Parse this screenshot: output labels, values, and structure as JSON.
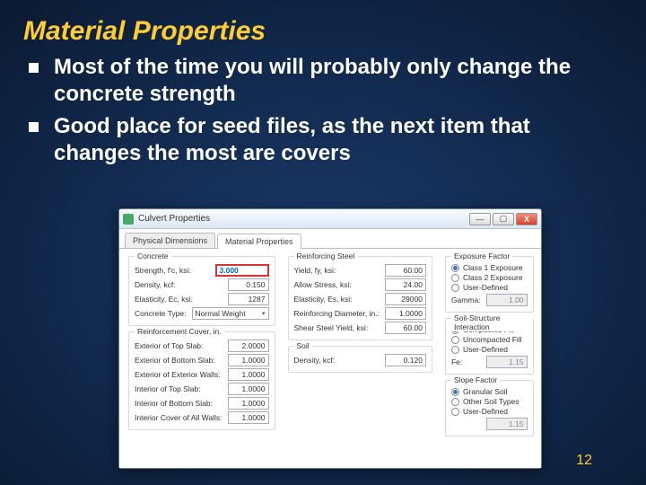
{
  "slide": {
    "title": "Material Properties",
    "bullets": [
      "Most of the time you will probably only change the concrete strength",
      "Good place for seed files, as the next item that changes the most are covers"
    ],
    "page": "12"
  },
  "win": {
    "title": "Culvert Properties",
    "btn_min": "—",
    "btn_max": "▢",
    "btn_close": "X",
    "tabs": [
      "Physical Dimensions",
      "Material Properties"
    ],
    "concrete": {
      "title": "Concrete",
      "strength_lbl": "Strength, f'c, ksi:",
      "strength_val": "3.000",
      "density_lbl": "Density, kcf:",
      "density_val": "0.150",
      "elasticity_lbl": "Elasticity, Ec, ksi:",
      "elasticity_val": "1287",
      "type_lbl": "Concrete Type:",
      "type_val": "Normal Weight"
    },
    "cover": {
      "title": "Reinforcement Cover, in.",
      "r1_lbl": "Exterior of Top Slab:",
      "r1_val": "2.0000",
      "r2_lbl": "Exterior of Bottom Slab:",
      "r2_val": "1.0000",
      "r3_lbl": "Exterior of Exterior Walls:",
      "r3_val": "1.0000",
      "r4_lbl": "Interior of Top Slab:",
      "r4_val": "1.0000",
      "r5_lbl": "Interior of Bottom Slab:",
      "r5_val": "1.0000",
      "r6_lbl": "Interior Cover of All Walls:",
      "r6_val": "1.0000"
    },
    "steel": {
      "title": "Reinforcing Steel",
      "yield_lbl": "Yield, fy, ksi:",
      "yield_val": "60.00",
      "allow_lbl": "Allow Stress, ksi:",
      "allow_val": "24.00",
      "elast_lbl": "Elasticity, Es, ksi:",
      "elast_val": "29000",
      "diam_lbl": "Reinforcing Diameter, in.:",
      "diam_val": "1.0000",
      "shear_lbl": "Shear Steel Yield, ksi:",
      "shear_val": "60.00"
    },
    "soil": {
      "title": "Soil",
      "density_lbl": "Density, kcf:",
      "density_val": "0.120"
    },
    "exposure": {
      "title": "Exposure Factor",
      "c1": "Class 1 Exposure",
      "c2": "Class 2 Exposure",
      "ud": "User-Defined",
      "gamma_lbl": "Gamma:",
      "gamma_val": "1.00"
    },
    "ssi": {
      "title": "Soil-Structure Interaction",
      "compacted": "Compacted Fill",
      "uncompacted": "Uncompacted Fill",
      "ud": "User-Defined",
      "fe_lbl": "Fe:",
      "fe_val": "1.15"
    },
    "slope": {
      "title": "Slope Factor",
      "granular": "Granular Soil",
      "other": "Other Soil Types",
      "ud": "User-Defined",
      "val": "1.15"
    }
  }
}
